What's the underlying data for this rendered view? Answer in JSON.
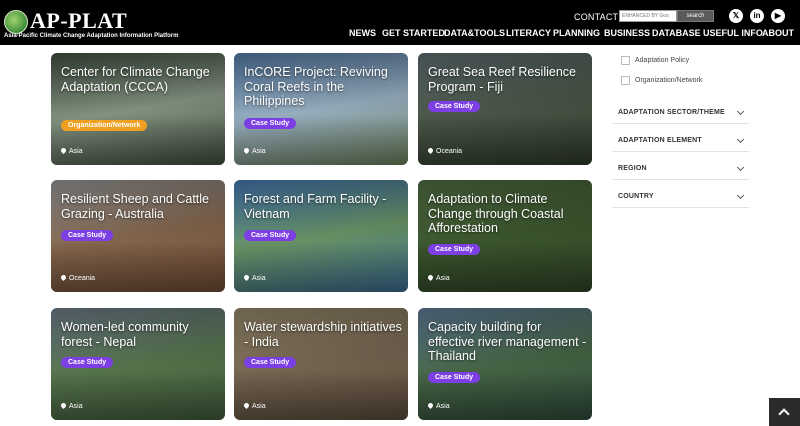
{
  "header": {
    "logo_text": "AP-PLAT",
    "logo_subtitle": "Asia-Pacific Climate Change Adaptation Information Platform",
    "contact": "CONTACT",
    "search_placeholder": "ENHANCED BY Goo",
    "search_button": "search",
    "social": [
      {
        "icon": "x-icon",
        "glyph": "𝕏"
      },
      {
        "icon": "linkedin-icon",
        "glyph": "in"
      },
      {
        "icon": "youtube-icon",
        "glyph": "▶"
      }
    ],
    "nav": [
      "NEWS",
      "GET STARTED",
      "DATA&TOOLS",
      "LITERACY",
      "PLANNING",
      "BUSINESS",
      "DATABASE",
      "USEFUL INFO",
      "ABOUT"
    ]
  },
  "cards": [
    {
      "title": "Center for Climate Change Adaptation (CCCA)",
      "badge": "Organization/Network",
      "badge_type": "org",
      "location": "Asia",
      "colors": [
        "#4a5a4a",
        "#8a9a88",
        "#3f4d3c"
      ]
    },
    {
      "title": "InCORE Project: Reviving Coral Reefs in the Philippines",
      "badge": "Case Study",
      "badge_type": "case",
      "location": "Asia",
      "colors": [
        "#5e88b8",
        "#9fb7c9",
        "#6a7f5a"
      ]
    },
    {
      "title": "Great Sea Reef Resilience Program - Fiji",
      "badge": "Case Study",
      "badge_type": "case",
      "location": "Oceania",
      "colors": [
        "#6a7a7e",
        "#4d5a4a",
        "#2f3a2a"
      ]
    },
    {
      "title": "Resilient Sheep and Cattle Grazing - Australia",
      "badge": "Case Study",
      "badge_type": "case",
      "location": "Oceania",
      "colors": [
        "#a8a8a8",
        "#8a6a50",
        "#6e4a34"
      ]
    },
    {
      "title": "Forest and Farm Facility - Vietnam",
      "badge": "Case Study",
      "badge_type": "case",
      "location": "Asia",
      "colors": [
        "#4c86c8",
        "#6e9a6a",
        "#3a6a90"
      ]
    },
    {
      "title": "Adaptation to Climate Change through Coastal Afforestation",
      "badge": "Case Study",
      "badge_type": "case",
      "location": "Asia",
      "colors": [
        "#5a7a4a",
        "#3e5a30",
        "#2e4426"
      ]
    },
    {
      "title": "Women-led community forest - Nepal",
      "badge": "Case Study",
      "badge_type": "case",
      "location": "Asia",
      "colors": [
        "#7a8a9a",
        "#5a7a50",
        "#3f5a3a"
      ]
    },
    {
      "title": "Water stewardship initiatives - India",
      "badge": "Case Study",
      "badge_type": "case",
      "location": "Asia",
      "colors": [
        "#a89878",
        "#7a6a55",
        "#5a4a3a"
      ]
    },
    {
      "title": "Capacity building for effective river management - Thailand",
      "badge": "Case Study",
      "badge_type": "case",
      "location": "Asia",
      "colors": [
        "#6a8aa8",
        "#4a6a48",
        "#2e4a3a"
      ]
    }
  ],
  "filters": {
    "checkboxes": [
      "Adaptation Policy",
      "Organization/Network"
    ],
    "facets": [
      "ADAPTATION SECTOR/THEME",
      "ADAPTATION ELEMENT",
      "REGION",
      "COUNTRY"
    ]
  }
}
